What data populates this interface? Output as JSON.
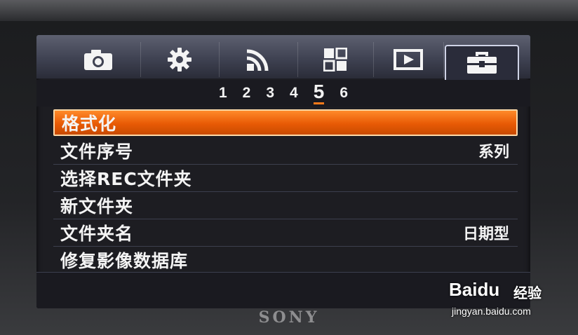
{
  "tabs": [
    {
      "icon": "camera-icon"
    },
    {
      "icon": "gear-icon"
    },
    {
      "icon": "wireless-icon"
    },
    {
      "icon": "apps-grid-icon"
    },
    {
      "icon": "playback-icon"
    },
    {
      "icon": "toolbox-icon",
      "active": true
    }
  ],
  "pages": [
    "1",
    "2",
    "3",
    "4",
    "5",
    "6"
  ],
  "active_page": "5",
  "menu": {
    "items": [
      {
        "label": "格式化",
        "value": ""
      },
      {
        "label": "文件序号",
        "value": "系列"
      },
      {
        "label": "选择REC文件夹",
        "value": ""
      },
      {
        "label": "新文件夹",
        "value": ""
      },
      {
        "label": "文件夹名",
        "value": "日期型"
      },
      {
        "label": "修复影像数据库",
        "value": ""
      }
    ]
  },
  "brand": "SONY",
  "watermark": {
    "logo": "Baidu",
    "cn": "经验",
    "url": "jingyan.baidu.com"
  },
  "colors": {
    "accent": "#e85a05",
    "tabbar": "#4a4d5e",
    "background": "#1d1d22"
  }
}
